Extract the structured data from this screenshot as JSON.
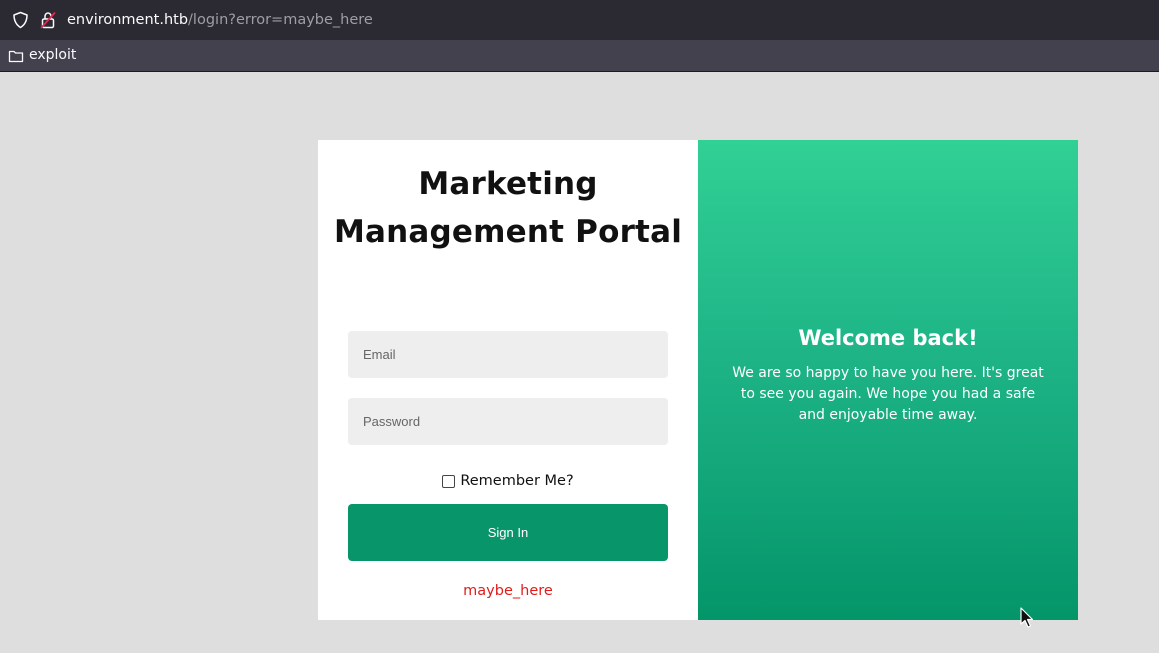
{
  "browser": {
    "url_host": "environment.htb",
    "url_path": "/login?error=maybe_here",
    "bookmarks": [
      {
        "label": "exploit",
        "icon": "folder-icon"
      }
    ]
  },
  "login": {
    "title": "Marketing Management Portal",
    "email_placeholder": "Email",
    "password_placeholder": "Password",
    "remember_label": "Remember Me?",
    "remember_checked": false,
    "signin_label": "Sign In",
    "error_message": "maybe_here"
  },
  "welcome": {
    "title": "Welcome back!",
    "text": "We are so happy to have you here. It's great to see you again. We hope you had a safe and enjoyable time away."
  },
  "colors": {
    "page_background": "#dedede",
    "accent_green": "#08956a",
    "gradient_top": "#31d095",
    "gradient_bottom": "#049569",
    "error_red": "#e11b1b"
  }
}
